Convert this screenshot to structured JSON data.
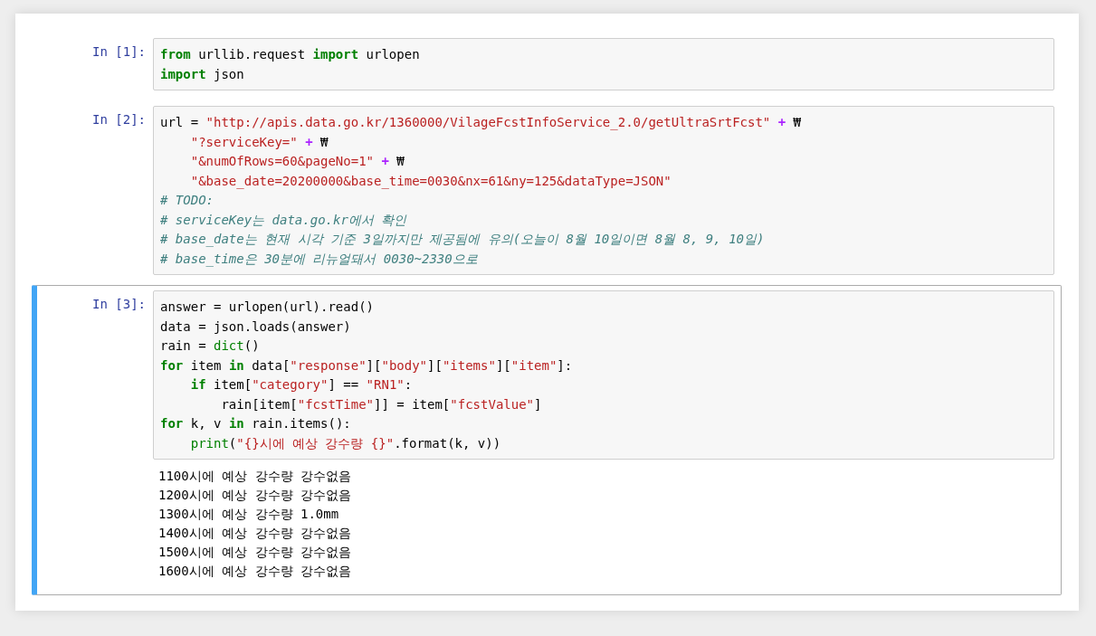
{
  "cells": [
    {
      "prompt": "In [1]:",
      "selected": false,
      "code": [
        [
          {
            "kind": "keyword",
            "text": "from"
          },
          {
            "kind": "plain",
            "text": " urllib.request "
          },
          {
            "kind": "keyword",
            "text": "import"
          },
          {
            "kind": "plain",
            "text": " urlopen"
          }
        ],
        [
          {
            "kind": "keyword",
            "text": "import"
          },
          {
            "kind": "plain",
            "text": " json"
          }
        ]
      ]
    },
    {
      "prompt": "In [2]:",
      "selected": false,
      "code": [
        [
          {
            "kind": "plain",
            "text": "url = "
          },
          {
            "kind": "string",
            "text": "\"http://apis.data.go.kr/1360000/VilageFcstInfoService_2.0/getUltraSrtFcst\""
          },
          {
            "kind": "operator",
            "text": " +"
          },
          {
            "kind": "plain",
            "text": " ₩"
          }
        ],
        [
          {
            "kind": "string",
            "text": "    \"?serviceKey=\""
          },
          {
            "kind": "operator",
            "text": " +"
          },
          {
            "kind": "plain",
            "text": " ₩"
          }
        ],
        [
          {
            "kind": "string",
            "text": "    \"&numOfRows=60&pageNo=1\""
          },
          {
            "kind": "operator",
            "text": " +"
          },
          {
            "kind": "plain",
            "text": " ₩"
          }
        ],
        [
          {
            "kind": "string",
            "text": "    \"&base_date=20200000&base_time=0030&nx=61&ny=125&dataType=JSON\""
          }
        ],
        [
          {
            "kind": "comment",
            "text": "# TODO:"
          }
        ],
        [
          {
            "kind": "comment",
            "text": "# serviceKey는 data.go.kr에서 확인"
          }
        ],
        [
          {
            "kind": "comment",
            "text": "# base_date는 현재 시각 기준 3일까지만 제공됨에 유의(오늘이 8월 10일이면 8월 8, 9, 10일)"
          }
        ],
        [
          {
            "kind": "comment",
            "text": "# base_time은 30분에 리뉴얼돼서 0030~2330으로"
          }
        ]
      ]
    },
    {
      "prompt": "In [3]:",
      "selected": true,
      "code": [
        [
          {
            "kind": "plain",
            "text": "answer = urlopen(url).read()"
          }
        ],
        [
          {
            "kind": "plain",
            "text": "data = json.loads(answer)"
          }
        ],
        [
          {
            "kind": "plain",
            "text": "rain = "
          },
          {
            "kind": "builtin",
            "text": "dict"
          },
          {
            "kind": "plain",
            "text": "()"
          }
        ],
        [
          {
            "kind": "keyword",
            "text": "for"
          },
          {
            "kind": "plain",
            "text": " item "
          },
          {
            "kind": "keyword",
            "text": "in"
          },
          {
            "kind": "plain",
            "text": " data["
          },
          {
            "kind": "string",
            "text": "\"response\""
          },
          {
            "kind": "plain",
            "text": "]["
          },
          {
            "kind": "string",
            "text": "\"body\""
          },
          {
            "kind": "plain",
            "text": "]["
          },
          {
            "kind": "string",
            "text": "\"items\""
          },
          {
            "kind": "plain",
            "text": "]["
          },
          {
            "kind": "string",
            "text": "\"item\""
          },
          {
            "kind": "plain",
            "text": "]:"
          }
        ],
        [
          {
            "kind": "keyword",
            "text": "    if"
          },
          {
            "kind": "plain",
            "text": " item["
          },
          {
            "kind": "string",
            "text": "\"category\""
          },
          {
            "kind": "plain",
            "text": "] == "
          },
          {
            "kind": "string",
            "text": "\"RN1\""
          },
          {
            "kind": "plain",
            "text": ":"
          }
        ],
        [
          {
            "kind": "plain",
            "text": "        rain[item["
          },
          {
            "kind": "string",
            "text": "\"fcstTime\""
          },
          {
            "kind": "plain",
            "text": "]] = item["
          },
          {
            "kind": "string",
            "text": "\"fcstValue\""
          },
          {
            "kind": "plain",
            "text": "]"
          }
        ],
        [
          {
            "kind": "keyword",
            "text": "for"
          },
          {
            "kind": "plain",
            "text": " k, v "
          },
          {
            "kind": "keyword",
            "text": "in"
          },
          {
            "kind": "plain",
            "text": " rain.items():"
          }
        ],
        [
          {
            "kind": "builtin",
            "text": "    print"
          },
          {
            "kind": "plain",
            "text": "("
          },
          {
            "kind": "string",
            "text": "\"{}시에 예상 강수량 {}\""
          },
          {
            "kind": "plain",
            "text": ".format(k, v))"
          }
        ]
      ],
      "output": [
        "1100시에 예상 강수량 강수없음",
        "1200시에 예상 강수량 강수없음",
        "1300시에 예상 강수량 1.0mm",
        "1400시에 예상 강수량 강수없음",
        "1500시에 예상 강수량 강수없음",
        "1600시에 예상 강수량 강수없음"
      ]
    }
  ]
}
